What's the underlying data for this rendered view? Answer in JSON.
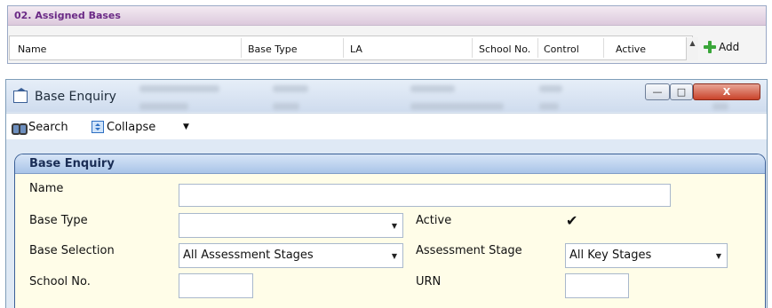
{
  "assigned_bases": {
    "title": "02. Assigned Bases",
    "columns": [
      "Name",
      "Base Type",
      "LA",
      "School No.",
      "Control",
      "Active"
    ],
    "add_label": "Add"
  },
  "window": {
    "title": "Base Enquiry",
    "controls": {
      "minimize": "—",
      "maximize": "□",
      "close": "X"
    }
  },
  "toolbar": {
    "search_label": "Search",
    "collapse_label": "Collapse",
    "collapse_caret": "▼"
  },
  "enquiry": {
    "header": "Base Enquiry",
    "fields": {
      "name": {
        "label": "Name",
        "value": ""
      },
      "base_type": {
        "label": "Base Type",
        "value": ""
      },
      "active": {
        "label": "Active",
        "checked_glyph": "✔"
      },
      "base_selection": {
        "label": "Base Selection",
        "value": "All Assessment Stages"
      },
      "assessment_stage": {
        "label": "Assessment Stage",
        "value": "All Key Stages"
      },
      "school_no": {
        "label": "School No.",
        "value": ""
      },
      "urn": {
        "label": "URN",
        "value": ""
      }
    }
  },
  "icons": {
    "add": "plus-icon",
    "search": "binoculars-icon",
    "collapse": "collapse-icon",
    "window": "building-icon",
    "dropdown": "▼",
    "scroll_up": "▲"
  },
  "colors": {
    "panel_title": "#6b2a86",
    "accent": "#3a5f96",
    "form_bg": "#fffde8",
    "add_green": "#3aa63a"
  }
}
